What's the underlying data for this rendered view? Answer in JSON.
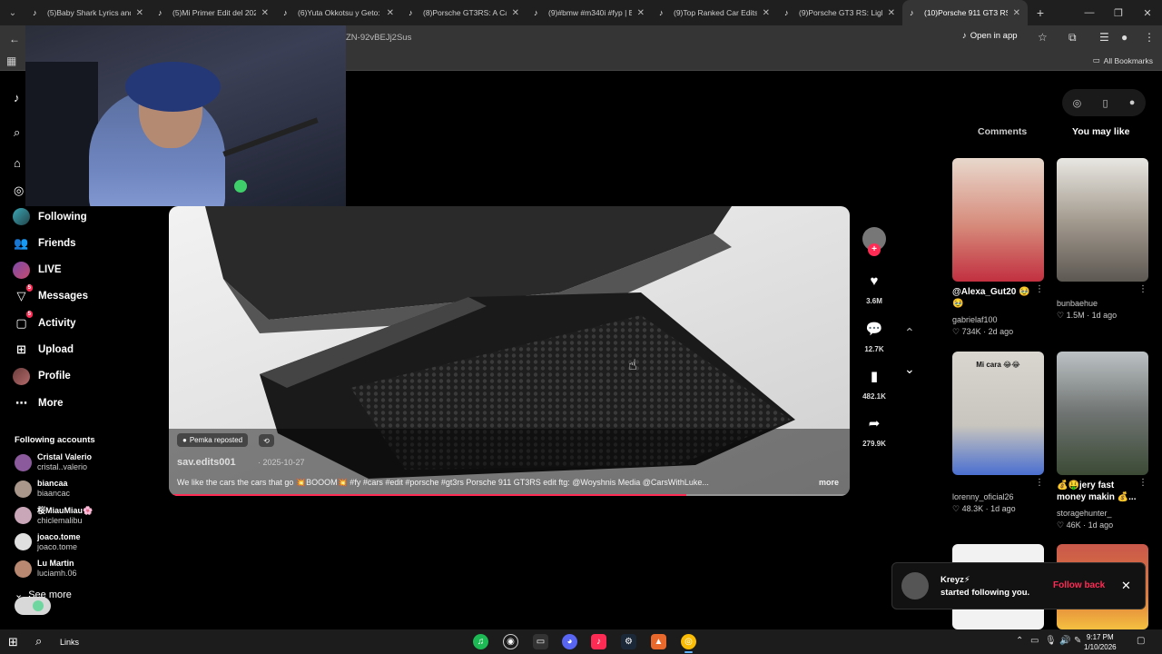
{
  "browser": {
    "tabs": [
      {
        "title": "(5)Baby Shark Lyrics and M",
        "active": false,
        "icon": "tiktok-icon"
      },
      {
        "title": "(5)Mi Primer Edit del 2026",
        "active": false,
        "icon": "tiktok-icon"
      },
      {
        "title": "(6)Yuta Okkotsu y Geto: E",
        "active": false,
        "icon": "tiktok-icon"
      },
      {
        "title": "(8)Porsche GT3RS: A Car E",
        "active": false,
        "icon": "tiktok-icon"
      },
      {
        "title": "(9)#bmw #m340i #fyp | B",
        "active": false,
        "icon": "tiktok-icon"
      },
      {
        "title": "(9)Top Ranked Car Edits: T",
        "active": false,
        "icon": "tiktok-icon"
      },
      {
        "title": "(9)Porsche GT3 RS: Lightw",
        "active": false,
        "icon": "tiktok-icon"
      },
      {
        "title": "(10)Porsche 911 GT3 RS: E",
        "active": true,
        "icon": "tiktok-icon"
      }
    ],
    "url_fragment": "ZN-92vBEJj2Sus",
    "open_in_app": "Open in app",
    "all_bookmarks": "All Bookmarks"
  },
  "sidebar": {
    "nav": [
      {
        "label": "Following",
        "icon": "following-avatar-icon",
        "badge": ""
      },
      {
        "label": "Friends",
        "icon": "friends-icon",
        "badge": ""
      },
      {
        "label": "LIVE",
        "icon": "live-avatar-icon",
        "badge": ""
      },
      {
        "label": "Messages",
        "icon": "messages-icon",
        "badge": "5"
      },
      {
        "label": "Activity",
        "icon": "activity-icon",
        "badge": "5"
      },
      {
        "label": "Upload",
        "icon": "upload-icon",
        "badge": ""
      },
      {
        "label": "Profile",
        "icon": "profile-avatar-icon",
        "badge": ""
      },
      {
        "label": "More",
        "icon": "more-icon",
        "badge": ""
      }
    ],
    "following_title": "Following accounts",
    "accounts": [
      {
        "name": "Cristal Valerio",
        "handle": "cristal..valerio"
      },
      {
        "name": "biancaa",
        "handle": "biaancac"
      },
      {
        "name": "桜MiauMiau🌸",
        "handle": "chiclemalibu"
      },
      {
        "name": "joaco.tome",
        "handle": "joaco.tome"
      },
      {
        "name": "Lu Martin",
        "handle": "luciamh.06"
      }
    ],
    "see_more": "See more"
  },
  "video": {
    "repost_label": "Pemka reposted",
    "author": "sav.edits001",
    "date": "· 2025-10-27",
    "caption": "We like the cars the cars that go 💥BOOOM💥 #fy #cars #edit #porsche #gt3rs Porsche 911 GT3RS edit ftg: @Woyshnis Media @CarsWithLuke...",
    "more": "more",
    "progress": 0.76
  },
  "actions": {
    "likes": "3.6M",
    "comments": "12.7K",
    "saves": "482.1K",
    "shares": "279.9K"
  },
  "right_panel": {
    "tab_comments": "Comments",
    "tab_you_may_like": "You may like",
    "cards": [
      {
        "title": "@Alexa_Gut20 🥹 🥹",
        "user": "gabrielaf100",
        "stats": "♡ 734K · 2d ago"
      },
      {
        "title": "",
        "user": "bunbaehue",
        "stats": "♡ 1.5M · 1d ago"
      },
      {
        "title": "",
        "user": "lorenny_oficial26",
        "stats": "♡ 48.3K · 1d ago",
        "overlay": "Mi cara 😂😂"
      },
      {
        "title": "💰🤑jery fast money makin 💰...",
        "user": "storagehunter_",
        "stats": "♡ 46K · 1d ago"
      }
    ]
  },
  "notification": {
    "name": "Kreyz⚡",
    "text": "started following you.",
    "action": "Follow back"
  },
  "taskbar": {
    "search_label": "Links",
    "time": "9:17 PM",
    "date": "1/10/2026"
  },
  "colors": {
    "accent": "#fe2c55",
    "background": "#000000",
    "chrome": "#353535"
  }
}
